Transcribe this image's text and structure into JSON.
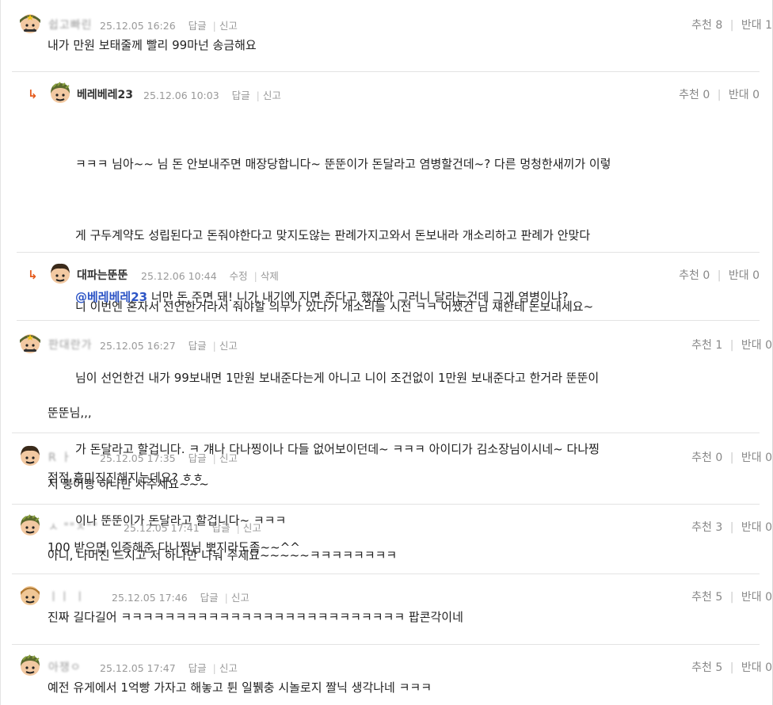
{
  "comments": [
    {
      "nick": "쉽고빠린",
      "date": "25.12.05 16:26",
      "reply_label": "답글",
      "report_label": "신고",
      "up_label": "추천",
      "up": "8",
      "down_label": "반대",
      "down": "1",
      "text": "내가 만원 보태줄께 빨리 99마넌 송금해요"
    },
    {
      "nick": "베레베레23",
      "date": "25.12.06 10:03",
      "reply_label": "답글",
      "report_label": "신고",
      "up_label": "추천",
      "up": "0",
      "down_label": "반대",
      "down": "0",
      "lines": [
        "ㅋㅋㅋ 님아~~ 님 돈 안보내주면 매장당합니다~ 뚠뚠이가 돈달라고 염병할건데~? 다른 멍청한새끼가 이렇",
        "게 구두계약도 성립된다고 돈줘야한다고 맞지도않는 판례가지고와서 돈보내라 개소리하고 판례가 안맞다",
        "니 이번엔 혼자서 선언한거라서 줘야할 의무가 있다가 개소리들 시전 ㅋㅋ 어쨌건 님 쟤한테 돈보내세요~",
        "님이 선언한건 내가 99보내면 1만원 보내준다는게 아니고 니이 조건없이 1만원 보내준다고 한거라 뚠뚠이",
        "가 돈달라고 할겁니다. ㅋ 걔나 다나찡이나 다들 없어보이던데~ ㅋㅋㅋ 아이디가 김소장님이시네~ 다나찡",
        "이나 뚠뚠이가 돈달라고 할겁니다~ ㅋㅋㅋ"
      ]
    },
    {
      "nick": "대파는뚠뚠",
      "date": "25.12.06 10:44",
      "edit_label": "수정",
      "delete_label": "삭제",
      "up_label": "추천",
      "up": "0",
      "down_label": "반대",
      "down": "0",
      "mention": "@베레베레23",
      "text": " 너만 돈 주면 돼! 니가 내기에 지면 준다고 했잖아 그러니 달라는건데 그게 염병이냐?"
    },
    {
      "nick": "판대란가",
      "date": "25.12.05 16:27",
      "reply_label": "답글",
      "report_label": "신고",
      "up_label": "추천",
      "up": "1",
      "down_label": "반대",
      "down": "0",
      "lines": [
        "뚠뚠님,,,",
        "저 붕어빵 하나만 사주세요~~~",
        "아니, 나머진 드시고 저 하나만 나눠 주세요~~~~~ㅋㅋㅋㅋㅋㅋㅋㅋ"
      ]
    },
    {
      "nick": "R    ㅏ",
      "date": "25.12.05 17:35",
      "reply_label": "답글",
      "report_label": "신고",
      "up_label": "추천",
      "up": "0",
      "down_label": "반대",
      "down": "0",
      "text": "점점 흥미진진해지는데요? ㅎㅎ"
    },
    {
      "nick": "ㅅ   \"\"ㅈ\"\"",
      "date": "25.12.05 17:41",
      "reply_label": "답글",
      "report_label": "신고",
      "up_label": "추천",
      "up": "3",
      "down_label": "반대",
      "down": "0",
      "text": "100 받으면 인증해준 다나찡님 뽀지라도좀~~^^"
    },
    {
      "nick": "ㅣㅣ     ㅣ",
      "date": "25.12.05 17:46",
      "reply_label": "답글",
      "report_label": "신고",
      "up_label": "추천",
      "up": "5",
      "down_label": "반대",
      "down": "0",
      "text": "진짜 길다길어 ㅋㅋㅋㅋㅋㅋㅋㅋㅋㅋㅋㅋㅋㅋㅋㅋㅋㅋㅋㅋㅋㅋㅋㅋㅋㅋ 팝콘각이네"
    },
    {
      "nick": "아쟁ㅇ",
      "date": "25.12.05 17:47",
      "reply_label": "답글",
      "report_label": "신고",
      "up_label": "추천",
      "up": "5",
      "down_label": "반대",
      "down": "0",
      "text": "예전 유게에서 1억빵 가자고 해놓고 튄 일뷁충 시놀로지 짤닉 생각나네 ㅋㅋㅋ"
    }
  ],
  "colors": {
    "accent": "#e45a1c",
    "mention": "#2d55c6"
  },
  "icons": {
    "reply_arrow": "↳"
  }
}
